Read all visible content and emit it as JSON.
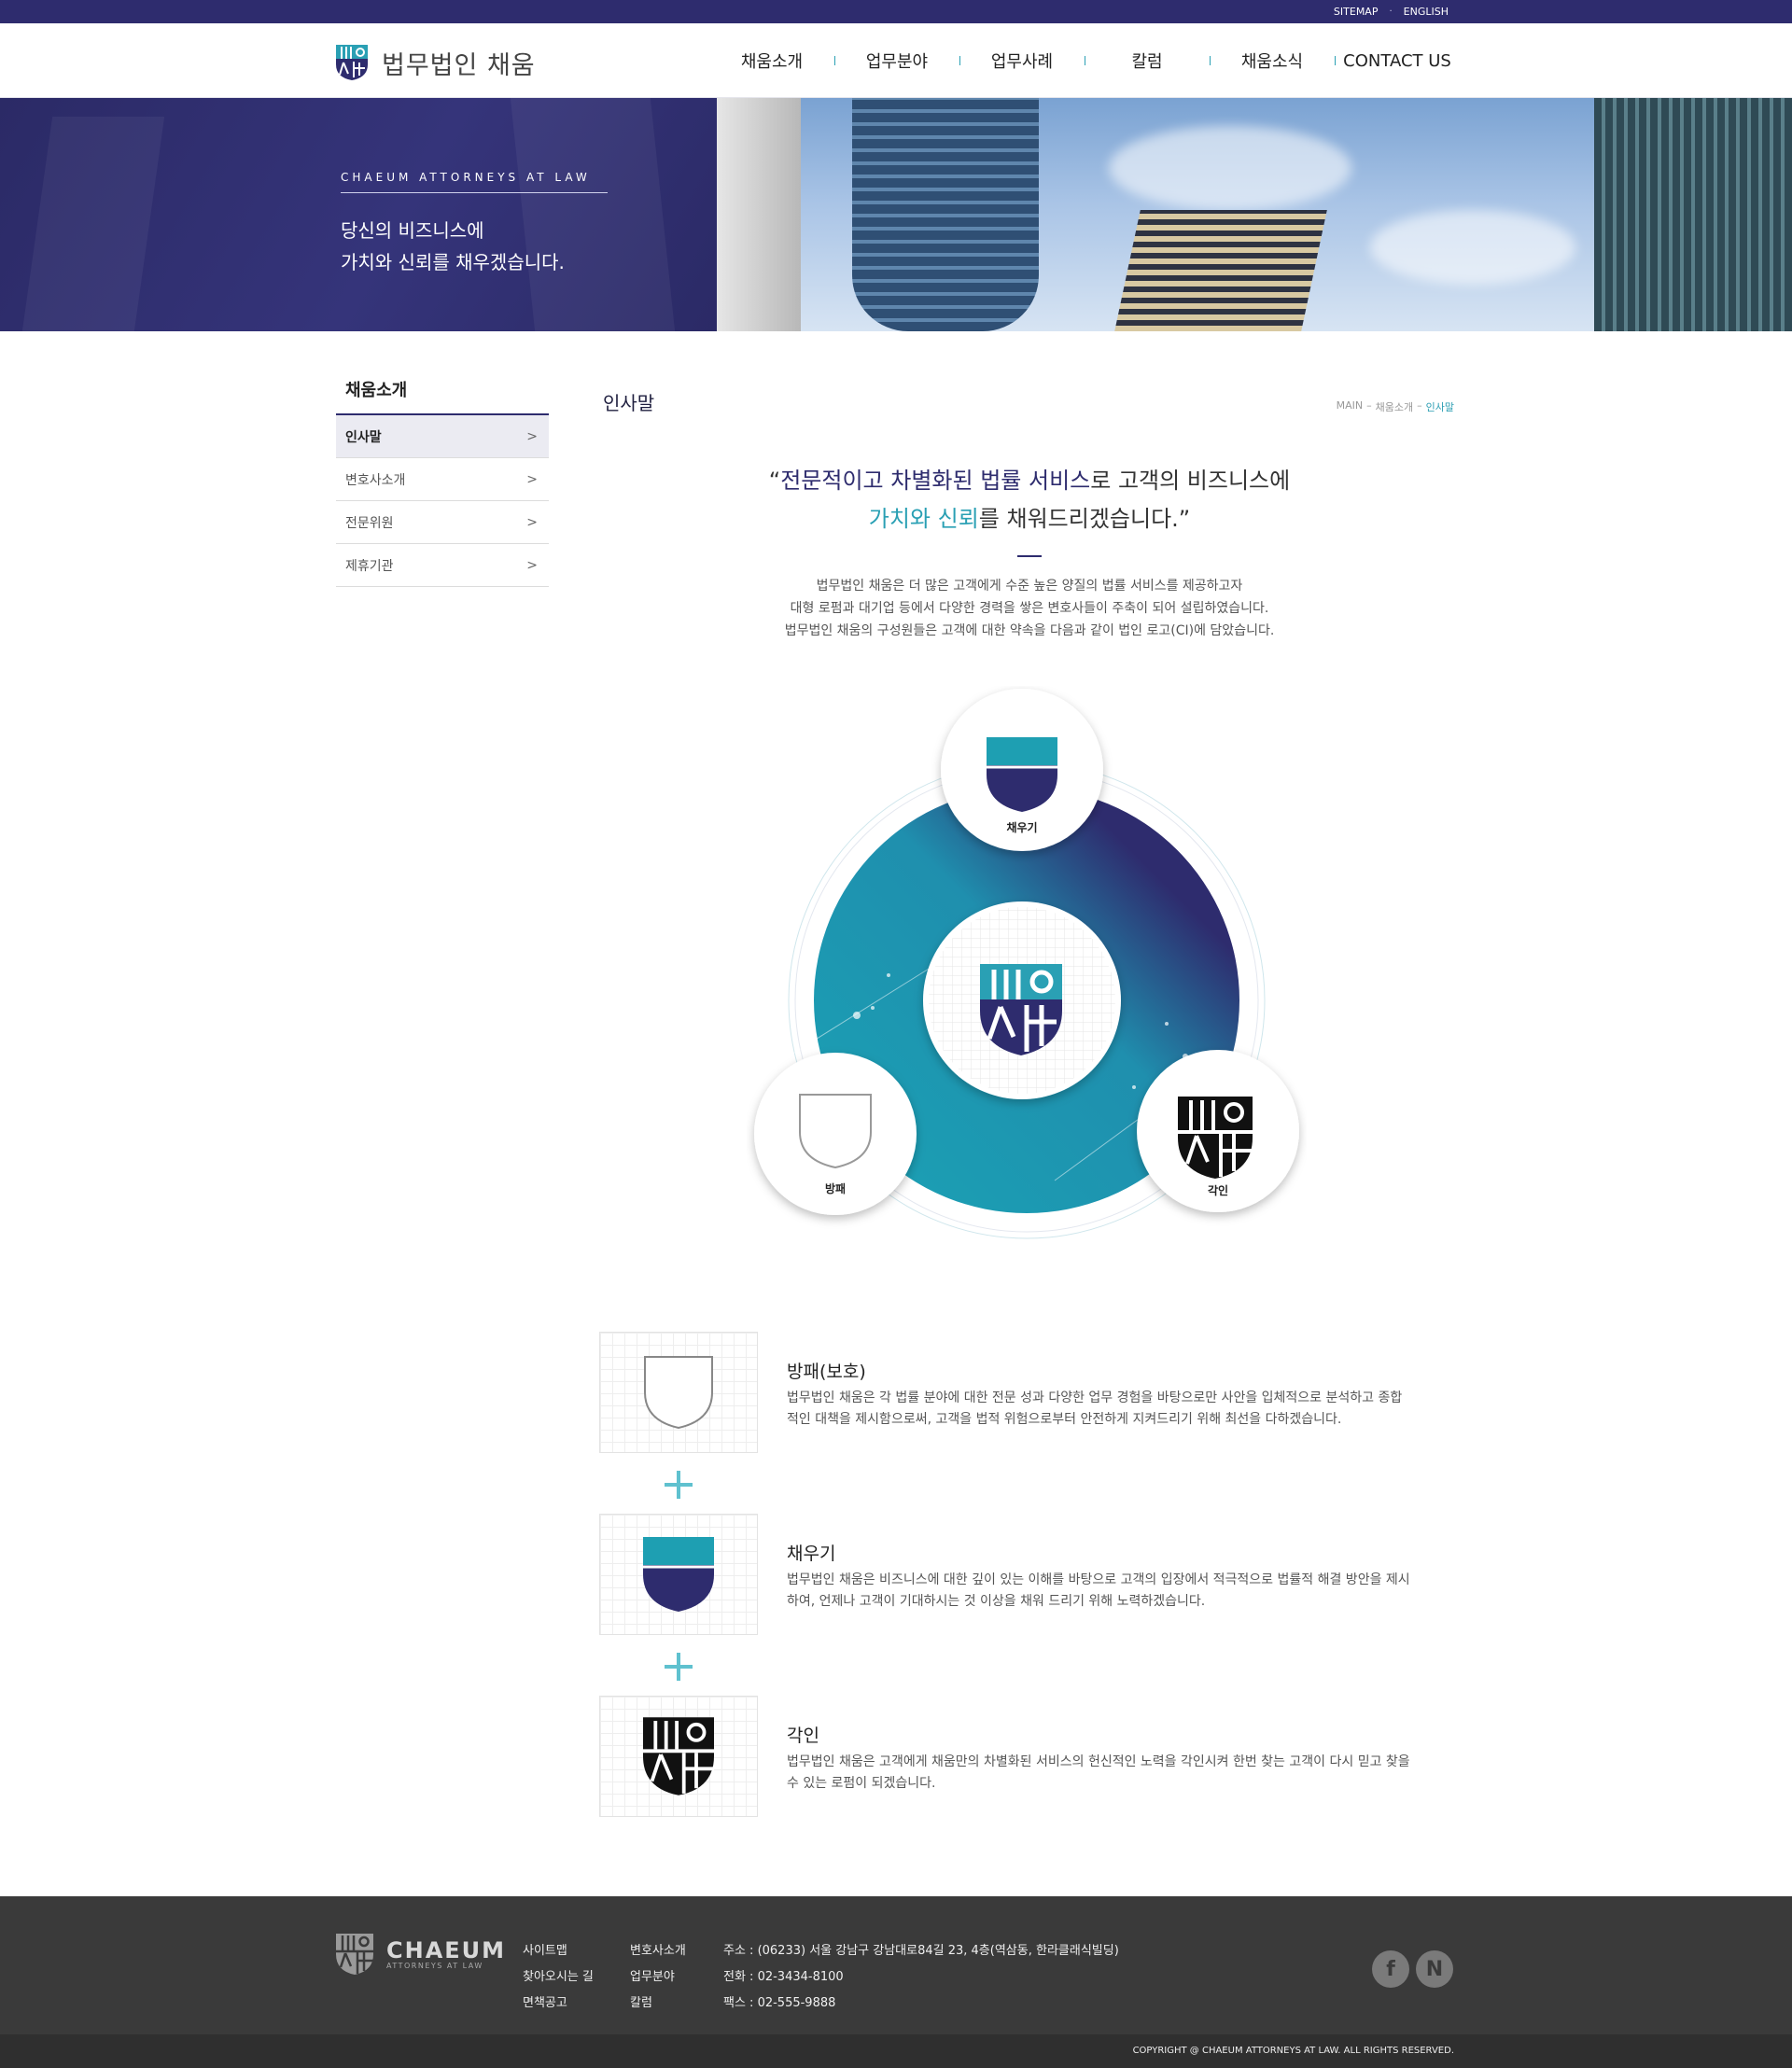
{
  "util": {
    "sitemap": "SITEMAP",
    "separator": "·",
    "english": "ENGLISH"
  },
  "header": {
    "logo_text": "법무법인 채움",
    "nav": [
      "채움소개",
      "업무분야",
      "업무사례",
      "칼럼",
      "채움소식",
      "CONTACT US"
    ]
  },
  "hero": {
    "eyebrow": "CHAEUM ATTORNEYS AT LAW",
    "line1": "당신의 비즈니스에",
    "line2": "가치와 신뢰를 채우겠습니다."
  },
  "sidebar": {
    "title": "채움소개",
    "items": [
      {
        "label": "인사말",
        "active": true
      },
      {
        "label": "변호사소개",
        "active": false
      },
      {
        "label": "전문위원",
        "active": false
      },
      {
        "label": "제휴기관",
        "active": false
      }
    ],
    "chevron": ">"
  },
  "content": {
    "title": "인사말",
    "breadcrumb": {
      "home": "MAIN",
      "sep": "–",
      "section": "채움소개",
      "current": "인사말"
    },
    "quote": {
      "open": "“",
      "navy": "전문적이고 차별화된 법률 서비스",
      "mid1": "로 고객의 비즈니스에",
      "teal": "가치와 신뢰",
      "mid2": "를 채워드리겠습니다.",
      "close": "”"
    },
    "intro": [
      "법무법인 채움은 더 많은 고객에게 수준 높은 양질의 법률 서비스를 제공하고자",
      "대형 로펌과 대기업 등에서 다양한 경력을 쌓은 변호사들이 주축이 되어 설립하였습니다.",
      "법무법인 채움의 구성원들은 고객에 대한 약속을 다음과 같이 법인 로고(CI)에 담았습니다."
    ]
  },
  "diagram": {
    "top_label": "채우기",
    "left_label": "방패",
    "right_label": "각인"
  },
  "items": [
    {
      "title": "방패(보호)",
      "desc": [
        "법무법인 채움은 각 법률 분야에 대한 전문 성과 다양한 업무 경험을 바탕으로만 사안을 입체적으로 분석하고 종합",
        "적인 대책을 제시함으로써, 고객을 법적 위험으로부터 안전하게 지켜드리기 위해 최선을 다하겠습니다."
      ]
    },
    {
      "title": "채우기",
      "desc": [
        "법무법인 채움은 비즈니스에 대한 깊이 있는 이해를 바탕으로 고객의 입장에서 적극적으로 법률적 해결 방안을 제시",
        "하여, 언제나 고객이 기대하시는 것 이상을 채워 드리기 위해 노력하겠습니다."
      ]
    },
    {
      "title": "각인",
      "desc": [
        "법무법인 채움은 고객에게 채움만의 차별화된 서비스의 헌신적인 노력을 각인시켜 한번 찾는 고객이 다시 믿고 찾을",
        "수 있는 로펌이 되겠습니다."
      ]
    }
  ],
  "footer": {
    "brand": "CHAEUM",
    "tagline": "ATTORNEYS AT LAW",
    "col1": [
      "사이트맵",
      "찾아오시는 길",
      "면책공고"
    ],
    "col2": [
      "변호사소개",
      "업무분야",
      "칼럼"
    ],
    "address": "주소 : (06233) 서울 강남구 강남대로84길 23, 4층(역삼동, 한라클래식빌딩)",
    "phone": "전화 : 02-3434-8100",
    "fax": "팩스 : 02-555-9888",
    "social": [
      "f",
      "N"
    ],
    "copyright": "COPYRIGHT @ CHAEUM ATTORNEYS AT LAW. ALL RIGHTS RESERVED."
  },
  "colors": {
    "navy": "#2e2c6e",
    "teal": "#2aa0b4",
    "footer": "#3a3a3a"
  }
}
